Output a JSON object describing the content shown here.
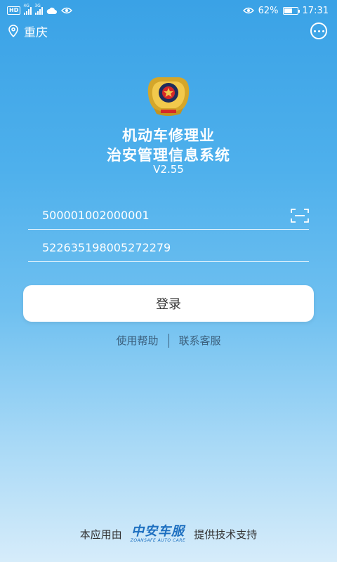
{
  "status_bar": {
    "net_4g": "4G",
    "net_3g": "3G",
    "battery": "62%",
    "battery_level": 0.62,
    "time": "17:31"
  },
  "header": {
    "location": "重庆",
    "location_icon": "map-pin-icon",
    "more_icon": "more-dots-icon"
  },
  "emblem": {
    "icon": "police-emblem-logo"
  },
  "title": {
    "line1": "机动车修理业",
    "line2": "治安管理信息系统",
    "version": "V2.55"
  },
  "form": {
    "account_value": "500001002000001",
    "id_value": "522635198005272279",
    "scan_icon": "scan-icon"
  },
  "login_label": "登录",
  "links": {
    "help": "使用帮助",
    "service": "联系客服"
  },
  "footer": {
    "prefix": "本应用由",
    "brand": "中安车服",
    "brand_sub": "ZOANSAFE AUTO CARE",
    "suffix": "提供技术支持"
  },
  "colors": {
    "bg_top": "#3aa2e6",
    "bg_bottom": "#d6ecfa",
    "brand": "#1c6fc0",
    "link": "#3b5f7c"
  }
}
